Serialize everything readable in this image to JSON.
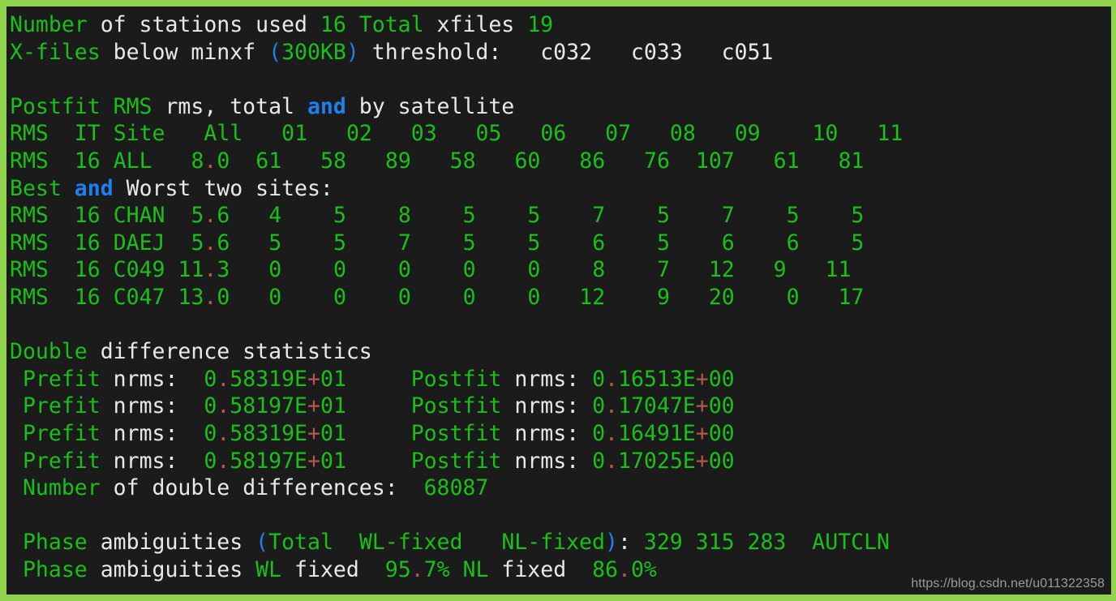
{
  "window": {
    "border_color": "#8fd44c",
    "background_color": "#1b1b1b",
    "default_text_color": "#e9e9e9",
    "green_color": "#18c018",
    "blue_color": "#1f7ff0",
    "red_color": "#b5564a"
  },
  "watermark": {
    "text": "https://blog.csdn.net/u011322358"
  },
  "summary": {
    "stations_label_1": "Number",
    "stations_label_2": " of stations used ",
    "stations_count": "16",
    "total_label": " Total",
    "xfiles_label": " xfiles ",
    "xfiles_count": "19",
    "xfiles_line_label_1": "X-files",
    "xfiles_line_label_2": " below minxf ",
    "paren_open": "(",
    "minxf_threshold": "300KB",
    "paren_close": ")",
    "threshold_label": " threshold:   ",
    "below_threshold_sites": "c032   c033   c051"
  },
  "postfit": {
    "heading_green": "Postfit RMS",
    "heading_white_1": " rms, total ",
    "heading_keyword": "and",
    "heading_white_2": " by satellite",
    "header_row": {
      "cols": [
        "RMS",
        "IT",
        "Site",
        "All",
        "01",
        "02",
        "03",
        "05",
        "06",
        "07",
        "08",
        "09",
        "10",
        "11"
      ]
    },
    "all_row": {
      "rms": "RMS",
      "it": "16",
      "site": "ALL",
      "all_int": "8",
      "all_dec": "0",
      "sats": [
        "61",
        "58",
        "89",
        "58",
        "60",
        "86",
        "76",
        "107",
        "61",
        "81"
      ]
    },
    "best_worst_heading_1": "Best ",
    "best_worst_keyword": "and",
    "best_worst_heading_2": " Worst two sites:",
    "site_rows": [
      {
        "rms": "RMS",
        "it": "16",
        "site": "CHAN",
        "all_int": "5",
        "all_dec": "6",
        "sats": [
          "4",
          "5",
          "8",
          "5",
          "5",
          "7",
          "5",
          "7",
          "5",
          "5"
        ]
      },
      {
        "rms": "RMS",
        "it": "16",
        "site": "DAEJ",
        "all_int": "5",
        "all_dec": "6",
        "sats": [
          "5",
          "5",
          "7",
          "5",
          "5",
          "6",
          "5",
          "6",
          "6",
          "5"
        ]
      },
      {
        "rms": "RMS",
        "it": "16",
        "site": "C049",
        "all_int": "11",
        "all_dec": "3",
        "sats": [
          "0",
          "0",
          "0",
          "0",
          "0",
          "8",
          "7",
          "12",
          "9",
          "11"
        ]
      },
      {
        "rms": "RMS",
        "it": "16",
        "site": "C047",
        "all_int": "13",
        "all_dec": "0",
        "sats": [
          "0",
          "0",
          "0",
          "0",
          "0",
          "12",
          "9",
          "20",
          "0",
          "17"
        ]
      }
    ]
  },
  "double_difference": {
    "heading_green": "Double",
    "heading_white": " difference statistics",
    "rows": [
      {
        "prefit_label_green": "Prefit",
        "prefit_label_white": " nrms:  ",
        "prefit_mantissa_int": "0",
        "prefit_mantissa_frac": "58319E",
        "prefit_exp_sign": "+",
        "prefit_exp": "01",
        "postfit_label_green": "Postfit",
        "postfit_label_white": " nrms: ",
        "postfit_mantissa_int": "0",
        "postfit_mantissa_frac": "16513E",
        "postfit_exp_sign": "+",
        "postfit_exp": "00"
      },
      {
        "prefit_label_green": "Prefit",
        "prefit_label_white": " nrms:  ",
        "prefit_mantissa_int": "0",
        "prefit_mantissa_frac": "58197E",
        "prefit_exp_sign": "+",
        "prefit_exp": "01",
        "postfit_label_green": "Postfit",
        "postfit_label_white": " nrms: ",
        "postfit_mantissa_int": "0",
        "postfit_mantissa_frac": "17047E",
        "postfit_exp_sign": "+",
        "postfit_exp": "00"
      },
      {
        "prefit_label_green": "Prefit",
        "prefit_label_white": " nrms:  ",
        "prefit_mantissa_int": "0",
        "prefit_mantissa_frac": "58319E",
        "prefit_exp_sign": "+",
        "prefit_exp": "01",
        "postfit_label_green": "Postfit",
        "postfit_label_white": " nrms: ",
        "postfit_mantissa_int": "0",
        "postfit_mantissa_frac": "16491E",
        "postfit_exp_sign": "+",
        "postfit_exp": "00"
      },
      {
        "prefit_label_green": "Prefit",
        "prefit_label_white": " nrms:  ",
        "prefit_mantissa_int": "0",
        "prefit_mantissa_frac": "58197E",
        "prefit_exp_sign": "+",
        "prefit_exp": "01",
        "postfit_label_green": "Postfit",
        "postfit_label_white": " nrms: ",
        "postfit_mantissa_int": "0",
        "postfit_mantissa_frac": "17025E",
        "postfit_exp_sign": "+",
        "postfit_exp": "00"
      }
    ],
    "count_label_green": "Number",
    "count_label_white": " of double differences:  ",
    "count_value": "68087"
  },
  "phase_ambiguities": {
    "line1": {
      "label_green": "Phase",
      "label_white": " ambiguities ",
      "paren_open": "(",
      "total_label": "Total",
      "wl_label": "  WL-fixed",
      "nl_label": "   NL-fixed",
      "paren_close": ")",
      "colon": ": ",
      "values": "329 315 283",
      "source": "  AUTCLN"
    },
    "line2": {
      "label_green": "Phase",
      "label_white": " ambiguities ",
      "wl_label": "WL",
      "fixed_label_1": " fixed  ",
      "wl_int": "95",
      "wl_frac": "7%",
      "nl_label": " NL",
      "fixed_label_2": " fixed  ",
      "nl_int": "86",
      "nl_frac": "0%"
    }
  }
}
